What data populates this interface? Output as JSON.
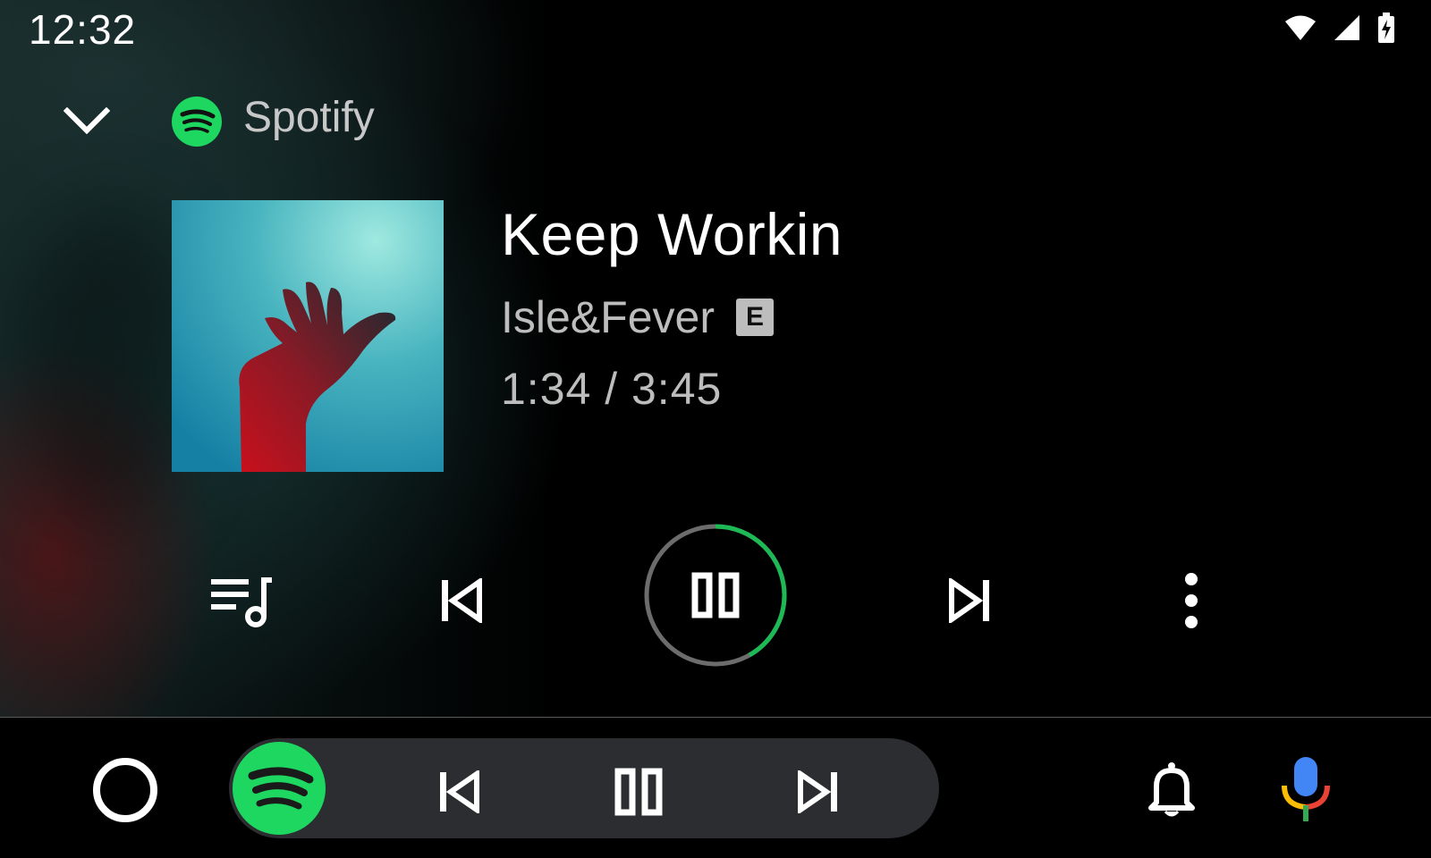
{
  "status_bar": {
    "time": "12:32",
    "icons": [
      "wifi-icon",
      "cellular-signal-icon",
      "battery-charging-icon"
    ]
  },
  "header": {
    "collapse_icon": "chevron-down-icon",
    "app_icon": "spotify-logo-icon",
    "app_name": "Spotify"
  },
  "now_playing": {
    "title": "Keep Workin",
    "artist": "Isle&Fever",
    "explicit_badge": "E",
    "time_display": "1:34 / 3:45",
    "progress_fraction": 0.418
  },
  "controls": {
    "queue_icon": "queue-music-icon",
    "previous_icon": "skip-previous-icon",
    "play_pause_icon": "pause-icon",
    "next_icon": "skip-next-icon",
    "more_icon": "more-vertical-icon"
  },
  "bottom_bar": {
    "home_icon": "home-circle-icon",
    "media_app_icon": "spotify-logo-icon",
    "previous_icon": "skip-previous-icon",
    "pause_icon": "pause-icon",
    "next_icon": "skip-next-icon",
    "notifications_icon": "bell-icon",
    "assistant_icon": "microphone-icon"
  },
  "colors": {
    "spotify_green": "#1ed760",
    "progress_green": "#1db954",
    "pill_background": "#2b2d31",
    "secondary_text": "#bdbdbd",
    "mic_blue": "#4285f4",
    "mic_red": "#ea4335",
    "mic_yellow": "#fbbc05",
    "mic_green": "#34a853"
  }
}
